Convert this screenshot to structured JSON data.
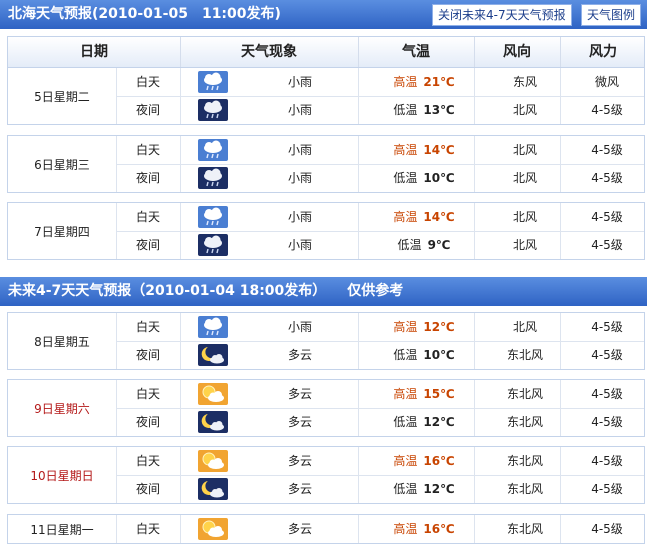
{
  "top_bar": {
    "title": "北海天气预报(2010-01-05　11:00发布)",
    "close_btn": "关闭未来4-7天天气预报",
    "legend_btn": "天气图例"
  },
  "header": {
    "date": "日期",
    "weather": "天气现象",
    "temp": "气温",
    "wind_dir": "风向",
    "wind_force": "风力"
  },
  "groups_1": [
    {
      "day": "5日星期二",
      "weekend": false,
      "rows": [
        {
          "period": "白天",
          "icon": "rain-day-icon",
          "weather": "小雨",
          "temp_label": "高温",
          "temp": "21℃",
          "wind_dir": "东风",
          "wind_force": "微风"
        },
        {
          "period": "夜间",
          "icon": "rain-night-icon",
          "weather": "小雨",
          "temp_label": "低温",
          "temp": "13℃",
          "wind_dir": "北风",
          "wind_force": "4-5级"
        }
      ]
    },
    {
      "day": "6日星期三",
      "weekend": false,
      "rows": [
        {
          "period": "白天",
          "icon": "rain-day-icon",
          "weather": "小雨",
          "temp_label": "高温",
          "temp": "14℃",
          "wind_dir": "北风",
          "wind_force": "4-5级"
        },
        {
          "period": "夜间",
          "icon": "rain-night-icon",
          "weather": "小雨",
          "temp_label": "低温",
          "temp": "10℃",
          "wind_dir": "北风",
          "wind_force": "4-5级"
        }
      ]
    },
    {
      "day": "7日星期四",
      "weekend": false,
      "rows": [
        {
          "period": "白天",
          "icon": "rain-day-icon",
          "weather": "小雨",
          "temp_label": "高温",
          "temp": "14℃",
          "wind_dir": "北风",
          "wind_force": "4-5级"
        },
        {
          "period": "夜间",
          "icon": "rain-night-icon",
          "weather": "小雨",
          "temp_label": "低温",
          "temp": "9℃",
          "wind_dir": "北风",
          "wind_force": "4-5级"
        }
      ]
    }
  ],
  "section2_title": "未来4-7天天气预报（2010-01-04 18:00发布）　　仅供参考",
  "groups_2": [
    {
      "day": "8日星期五",
      "weekend": false,
      "rows": [
        {
          "period": "白天",
          "icon": "rain-day-icon",
          "weather": "小雨",
          "temp_label": "高温",
          "temp": "12℃",
          "wind_dir": "北风",
          "wind_force": "4-5级"
        },
        {
          "period": "夜间",
          "icon": "cloudy-night-icon",
          "weather": "多云",
          "temp_label": "低温",
          "temp": "10℃",
          "wind_dir": "东北风",
          "wind_force": "4-5级"
        }
      ]
    },
    {
      "day": "9日星期六",
      "weekend": true,
      "rows": [
        {
          "period": "白天",
          "icon": "cloudy-day-icon",
          "weather": "多云",
          "temp_label": "高温",
          "temp": "15℃",
          "wind_dir": "东北风",
          "wind_force": "4-5级"
        },
        {
          "period": "夜间",
          "icon": "cloudy-night-icon",
          "weather": "多云",
          "temp_label": "低温",
          "temp": "12℃",
          "wind_dir": "东北风",
          "wind_force": "4-5级"
        }
      ]
    },
    {
      "day": "10日星期日",
      "weekend": true,
      "rows": [
        {
          "period": "白天",
          "icon": "cloudy-day-icon",
          "weather": "多云",
          "temp_label": "高温",
          "temp": "16℃",
          "wind_dir": "东北风",
          "wind_force": "4-5级"
        },
        {
          "period": "夜间",
          "icon": "cloudy-night-icon",
          "weather": "多云",
          "temp_label": "低温",
          "temp": "12℃",
          "wind_dir": "东北风",
          "wind_force": "4-5级"
        }
      ]
    },
    {
      "day": "11日星期一",
      "weekend": false,
      "rows": [
        {
          "period": "白天",
          "icon": "cloudy-day-icon",
          "weather": "多云",
          "temp_label": "高温",
          "temp": "16℃",
          "wind_dir": "东北风",
          "wind_force": "4-5级"
        }
      ]
    }
  ],
  "colors": {
    "bar": "#3a70cf",
    "high_temp": "#c84400",
    "weekend_day": "#b41818",
    "border": "#c4d3ea"
  }
}
